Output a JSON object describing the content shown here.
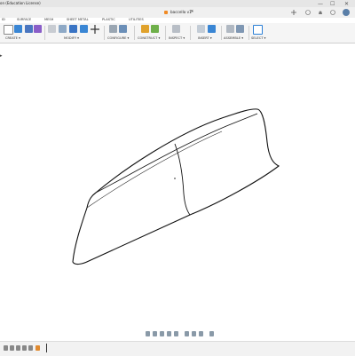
{
  "window": {
    "title": "on (Education License)",
    "minimize_glyph": "—",
    "maximize_glyph": "☐",
    "close_glyph": "✕"
  },
  "document": {
    "tab_title": "baccello v1*",
    "close_glyph": "×"
  },
  "tabs": [
    "ID",
    "SURFACE",
    "MESH",
    "SHEET METAL",
    "PLASTIC",
    "UTILITIES"
  ],
  "toolbar_groups": {
    "create": "CREATE ▾",
    "modify": "MODIFY ▾",
    "configure": "CONFIGURE ▾",
    "construct": "CONSTRUCT ▾",
    "inspect": "INSPECT ▾",
    "insert": "INSERT ▾",
    "assemble": "ASSEMBLE ▾",
    "select": "SELECT ▾"
  },
  "browser_marker": "▸",
  "colors": {
    "accent_blue": "#2b7fd6",
    "document_orange": "#f08a24",
    "model_edge": "#111111"
  },
  "icons": [
    "create-sketch-icon",
    "box-icon",
    "extrude-icon",
    "cylinder-icon",
    "press-pull-icon",
    "fillet-icon",
    "combine-icon",
    "move-icon",
    "configure-icon",
    "offset-plane-icon",
    "axis-icon",
    "measure-icon",
    "insert-image-icon",
    "joint-icon",
    "select-icon",
    "orbit-icon",
    "pan-icon",
    "zoom-icon",
    "fit-icon",
    "display-settings-icon",
    "grid-icon",
    "viewport-icon",
    "timeline-play-icon"
  ]
}
